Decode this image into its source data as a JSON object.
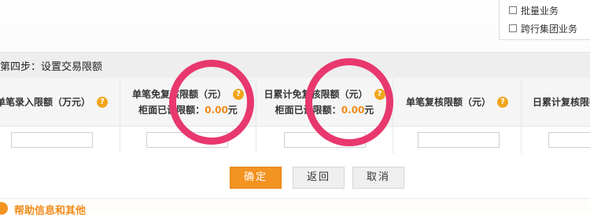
{
  "business_options": [
    {
      "label": "批量业务",
      "checked": false
    },
    {
      "label": "跨行集团业务",
      "checked": false
    }
  ],
  "step": {
    "title": "第四步：设置交易限额"
  },
  "limits": {
    "columns": [
      {
        "label": "单笔录入限额（万元）",
        "help": "?",
        "value": ""
      },
      {
        "label": "单笔免复核限额（元）",
        "help": "?",
        "sub_label": "柜面已设限额：",
        "sub_value": "0.00",
        "sub_unit": "元",
        "value": ""
      },
      {
        "label": "日累计免复核限额（元）",
        "help": "?",
        "sub_label": "柜面已设限额：",
        "sub_value": "0.00",
        "sub_unit": "元",
        "value": ""
      },
      {
        "label": "单笔复核限额（元）",
        "help": "?",
        "value": ""
      },
      {
        "label": "日累计复核限额",
        "help": "?",
        "value": ""
      }
    ]
  },
  "actions": {
    "confirm": "确定",
    "back": "返回",
    "cancel": "取消"
  },
  "help_section": {
    "title": "帮助信息和其他"
  },
  "colors": {
    "accent": "#f39321",
    "highlight_value": "#f08c1a",
    "annotation_ring": "#e8386e"
  },
  "icons": {
    "help": "question-circle-icon",
    "checkbox": "checkbox-icon",
    "help_section": "info-circle-icon"
  }
}
